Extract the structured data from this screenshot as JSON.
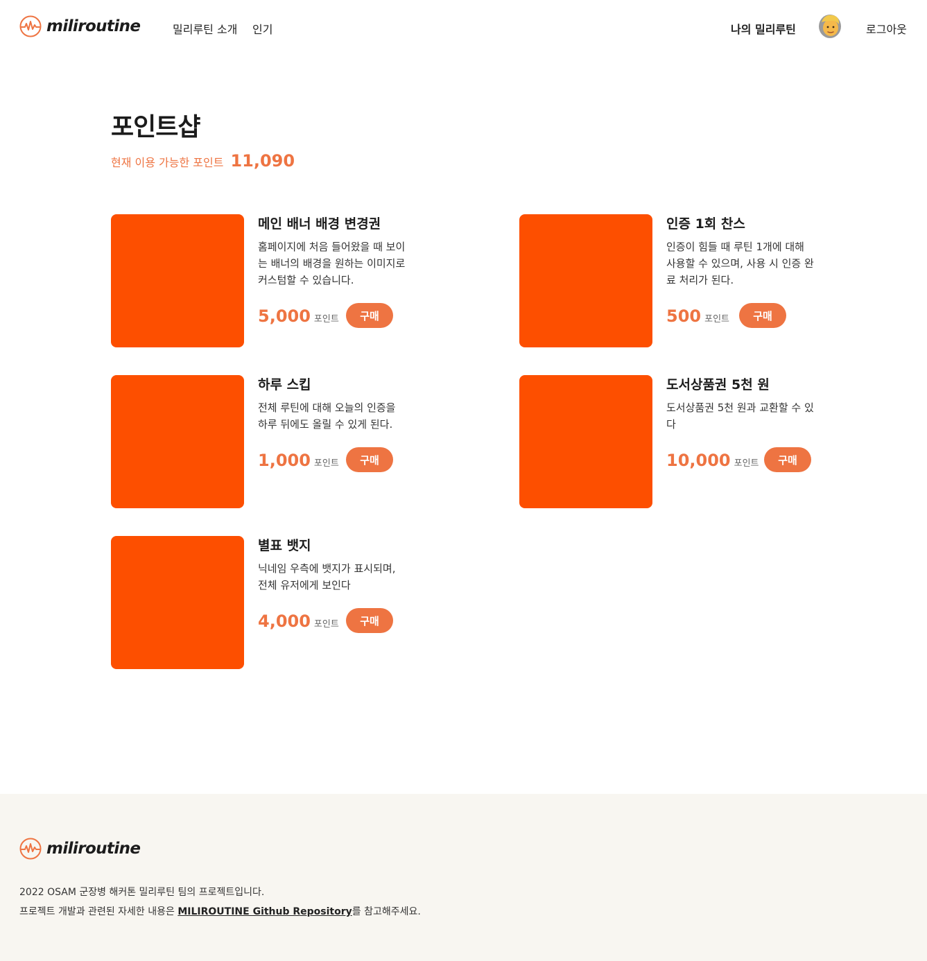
{
  "colors": {
    "accent": "#ee7442",
    "thumbnail": "#fd4f00",
    "footer_bg": "#f8f6f1"
  },
  "header": {
    "logo_text": "miliroutine",
    "logo_icon": "pulse-circle-icon",
    "nav": {
      "intro": "밀리루틴 소개",
      "popular": "인기"
    },
    "my_routine": "나의 밀리루틴",
    "avatar_icon": "person-emoji-avatar",
    "logout": "로그아웃"
  },
  "main": {
    "title": "포인트샵",
    "points_label": "현재 이용 가능한 포인트",
    "points_value": "11,090"
  },
  "items": [
    {
      "name": "메인 배너 배경 변경권",
      "description": "홈페이지에 처음 들어왔을 때 보이는 배너의 배경을 원하는 이미지로 커스텀할 수 있습니다.",
      "price": "5,000",
      "unit": "포인트",
      "buy": "구매"
    },
    {
      "name": "인증 1회 찬스",
      "description": "인증이 힘들 때 루틴 1개에 대해 사용할 수 있으며, 사용 시 인증 완료 처리가 된다.",
      "price": "500",
      "unit": "포인트",
      "buy": "구매"
    },
    {
      "name": "하루 스킵",
      "description": "전체 루틴에 대해 오늘의 인증을 하루 뒤에도 올릴 수 있게 된다.",
      "price": "1,000",
      "unit": "포인트",
      "buy": "구매"
    },
    {
      "name": "도서상품권 5천 원",
      "description": "도서상품권 5천 원과 교환할 수 있다",
      "price": "10,000",
      "unit": "포인트",
      "buy": "구매"
    },
    {
      "name": "별표 뱃지",
      "description": "닉네임 우측에 뱃지가 표시되며, 전체 유저에게 보인다",
      "price": "4,000",
      "unit": "포인트",
      "buy": "구매"
    }
  ],
  "footer": {
    "logo_text": "miliroutine",
    "line1": "2022 OSAM 군장병 해커톤 밀리루틴 팀의 프로젝트입니다.",
    "line2_prefix": "프로젝트 개발과 관련된 자세한 내용은 ",
    "repo_link": "MILIROUTINE Github Repository",
    "line2_suffix": "를 참고해주세요."
  }
}
